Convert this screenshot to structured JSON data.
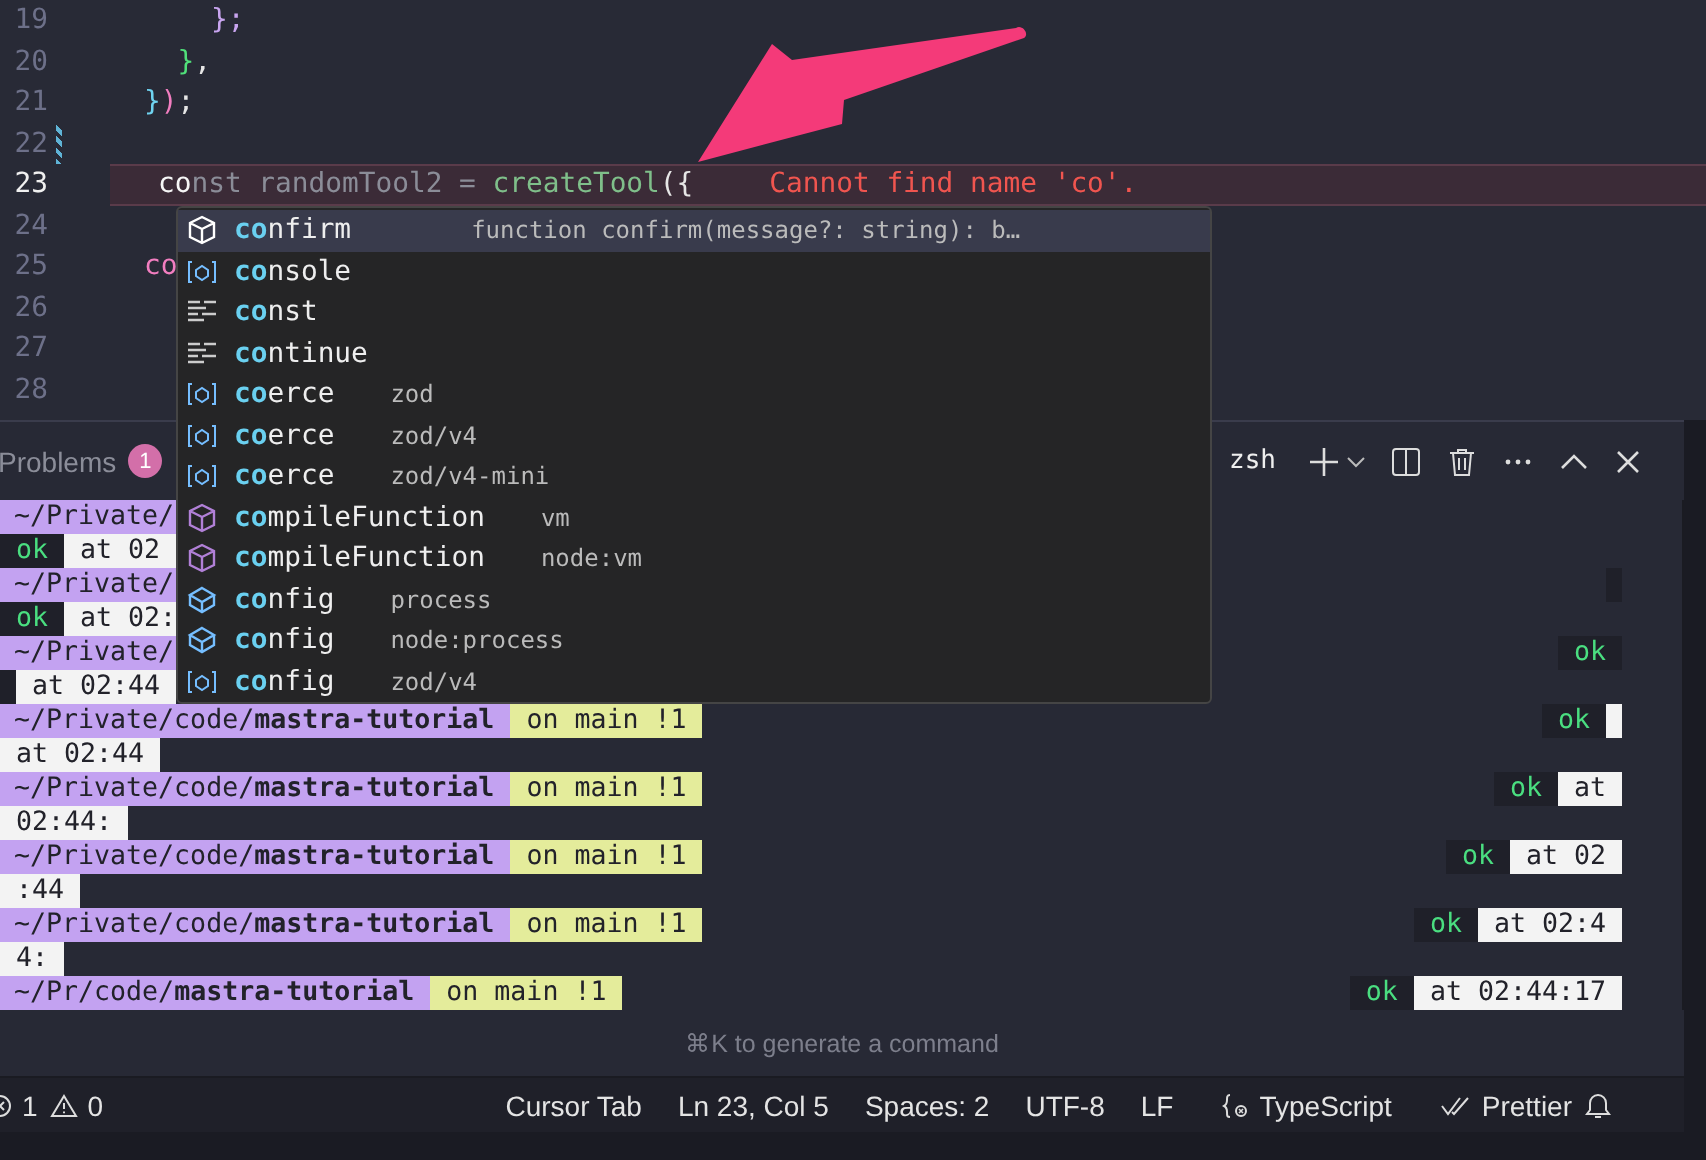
{
  "editor": {
    "lines": [
      {
        "number": "19",
        "active": false,
        "tokens": [
          {
            "kind": "bracket-purple",
            "text": "    };"
          }
        ]
      },
      {
        "number": "20",
        "active": false,
        "tokens": [
          {
            "kind": "bracket-green",
            "text": "  }"
          },
          {
            "kind": "punct",
            "text": ","
          }
        ]
      },
      {
        "number": "21",
        "active": false,
        "tokens": [
          {
            "kind": "bracket-cyan",
            "text": "}"
          },
          {
            "kind": "paren-pink",
            "text": ")"
          },
          {
            "kind": "punct",
            "text": ";"
          }
        ]
      },
      {
        "number": "22",
        "active": false
      },
      {
        "number": "23",
        "active": true,
        "tokens": [
          {
            "kind": "typed",
            "text": "co"
          },
          {
            "kind": "ghost",
            "text": "nst randomTool2 = "
          },
          {
            "kind": "function",
            "text": "createTool"
          },
          {
            "kind": "punct",
            "text": "({"
          }
        ],
        "error": "Cannot find name 'co'."
      },
      {
        "number": "24",
        "active": false
      },
      {
        "number": "25",
        "active": false,
        "tokens": [
          {
            "kind": "keyword",
            "text": "co"
          }
        ]
      },
      {
        "number": "26",
        "active": false
      },
      {
        "number": "27",
        "active": false
      },
      {
        "number": "28",
        "active": false
      }
    ]
  },
  "suggestions": [
    {
      "kind": "method",
      "label": "**co**nfirm",
      "detail": "function confirm(message?: string): b…",
      "selected": true
    },
    {
      "kind": "variable",
      "label": "**co**nsole",
      "selected": false
    },
    {
      "kind": "keyword",
      "label": "**co**nst",
      "selected": false
    },
    {
      "kind": "keyword",
      "label": "**co**ntinue",
      "selected": false
    },
    {
      "kind": "variable",
      "label": "**co**erce",
      "detail": "zod",
      "selected": false
    },
    {
      "kind": "variable",
      "label": "**co**erce",
      "detail": "zod/v4",
      "selected": false
    },
    {
      "kind": "variable",
      "label": "**co**erce",
      "detail": "zod/v4-mini",
      "selected": false
    },
    {
      "kind": "method",
      "label": "**co**mpileFunction",
      "detail": "vm",
      "selected": false
    },
    {
      "kind": "method",
      "label": "**co**mpileFunction",
      "detail": "node:vm",
      "selected": false
    },
    {
      "kind": "module",
      "label": "**co**nfig",
      "detail": "process",
      "selected": false
    },
    {
      "kind": "module",
      "label": "**co**nfig",
      "detail": "node:process",
      "selected": false
    },
    {
      "kind": "variable",
      "label": "**co**nfig",
      "detail": "zod/v4",
      "selected": false
    }
  ],
  "panel": {
    "tab": {
      "label": "Problems",
      "count": "1"
    },
    "terminal_name": "zsh"
  },
  "terminal": [
    {
      "kind": "prompt",
      "path": "~/Private/"
    },
    {
      "kind": "status",
      "left": [
        {
          "kind": "ok",
          "text": "ok"
        },
        {
          "kind": "time",
          "text": "at 02"
        }
      ]
    },
    {
      "kind": "prompt",
      "path": "~/Private/",
      "right": [
        {
          "kind": "blank"
        }
      ]
    },
    {
      "kind": "status",
      "left": [
        {
          "kind": "ok",
          "text": "ok"
        },
        {
          "kind": "time",
          "text": "at 02:"
        }
      ]
    },
    {
      "kind": "prompt",
      "path": "~/Private/",
      "right": [
        {
          "kind": "ok",
          "text": "ok"
        }
      ]
    },
    {
      "kind": "status",
      "left": [
        {
          "kind": "blank"
        },
        {
          "kind": "time",
          "text": "at 02:44"
        }
      ]
    },
    {
      "kind": "prompt",
      "path": "~/Private/code/**mastra-tutorial**",
      "branch": "on main !1",
      "right": [
        {
          "kind": "ok",
          "text": "ok"
        },
        {
          "kind": "blank-light"
        }
      ]
    },
    {
      "kind": "status",
      "left": [
        {
          "kind": "time",
          "text": "at 02:44"
        }
      ]
    },
    {
      "kind": "prompt",
      "path": "~/Private/code/**mastra-tutorial**",
      "branch": "on main !1",
      "right": [
        {
          "kind": "ok",
          "text": "ok"
        },
        {
          "kind": "time",
          "text": "at"
        }
      ]
    },
    {
      "kind": "status",
      "left": [
        {
          "kind": "time",
          "text": "02:44:"
        }
      ]
    },
    {
      "kind": "prompt",
      "path": "~/Private/code/**mastra-tutorial**",
      "branch": "on main !1",
      "right": [
        {
          "kind": "ok",
          "text": "ok"
        },
        {
          "kind": "time",
          "text": "at 02"
        }
      ]
    },
    {
      "kind": "status",
      "left": [
        {
          "kind": "time",
          "text": ":44"
        }
      ]
    },
    {
      "kind": "prompt",
      "path": "~/Private/code/**mastra-tutorial**",
      "branch": "on main !1",
      "right": [
        {
          "kind": "ok",
          "text": "ok"
        },
        {
          "kind": "time",
          "text": "at 02:4"
        }
      ]
    },
    {
      "kind": "status",
      "left": [
        {
          "kind": "time",
          "text": "4:"
        }
      ]
    },
    {
      "kind": "prompt",
      "path": "~/Pr/code/**mastra-tutorial**",
      "branch": "on main !1",
      "right": [
        {
          "kind": "ok",
          "text": "ok"
        },
        {
          "kind": "time",
          "text": "at 02:44:17"
        }
      ]
    }
  ],
  "hint": "⌘K to generate a command",
  "status_bar": {
    "errors": "1",
    "warnings": "0",
    "items": [
      {
        "kind": "text",
        "label": "Cursor Tab"
      },
      {
        "kind": "text",
        "label": "Ln 23, Col 5"
      },
      {
        "kind": "text",
        "label": "Spaces: 2"
      },
      {
        "kind": "text",
        "label": "UTF-8"
      },
      {
        "kind": "text",
        "label": "LF"
      },
      {
        "kind": "language",
        "label": "TypeScript"
      },
      {
        "kind": "formatter",
        "label": "Prettier"
      },
      {
        "kind": "bell"
      }
    ]
  }
}
